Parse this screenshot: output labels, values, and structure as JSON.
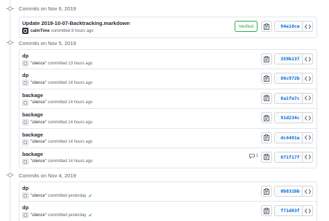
{
  "groups": [
    {
      "title": "Commits on Nov 6, 2019",
      "commits": [
        {
          "message": "Update 2019-10-07-Backtracking.markdown",
          "author": "calmTime",
          "time_text": "committed 8 hours ago",
          "verified_label": "Verified",
          "sha": "94e18ce",
          "dark_avatar": true
        }
      ]
    },
    {
      "title": "Commits on Nov 5, 2019",
      "commits": [
        {
          "message": "dp",
          "author": "\"silence\"",
          "time_text": "committed 13 hours ago",
          "sha": "359b137"
        },
        {
          "message": "dp",
          "author": "\"silence\"",
          "time_text": "committed 14 hours ago",
          "sha": "86c972b"
        },
        {
          "message": "backage",
          "author": "\"silence\"",
          "time_text": "committed 14 hours ago",
          "sha": "8a1fe7c"
        },
        {
          "message": "backage",
          "author": "\"silence\"",
          "time_text": "committed 14 hours ago",
          "sha": "91d234c"
        },
        {
          "message": "backage",
          "author": "\"silence\"",
          "time_text": "committed 14 hours ago",
          "sha": "dc4491e"
        },
        {
          "message": "backage",
          "author": "\"silence\"",
          "time_text": "committed 14 hours ago",
          "sha": "871f17f",
          "comment_count": "1"
        }
      ]
    },
    {
      "title": "Commits on Nov 4, 2019",
      "commits": [
        {
          "message": "dp",
          "author": "\"silence\"",
          "time_text": "committed yesterday",
          "sha": "0b831bb",
          "status": "success"
        },
        {
          "message": "dp",
          "author": "\"silence\"",
          "time_text": "committed yesterday",
          "sha": "f71d83f",
          "status": "success"
        }
      ]
    }
  ],
  "icons": {
    "commit_group": "git-commit-icon",
    "copy": "clipboard-icon",
    "browse": "code-icon",
    "comment": "comment-icon",
    "check": "check-icon"
  },
  "colors": {
    "link": "#0366d6",
    "verified": "#28a745",
    "border": "#e1e4e8",
    "muted": "#586069"
  }
}
